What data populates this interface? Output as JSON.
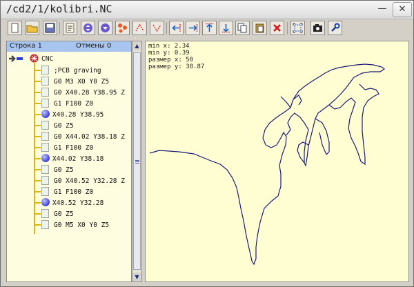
{
  "window": {
    "title": "/cd2/1/kolibri.NC"
  },
  "titlebar_buttons": {
    "minimize": "—",
    "close": "✕"
  },
  "toolbar": {
    "icons": [
      "new-file-icon",
      "open-folder-icon",
      "save-icon",
      "gcode-file-icon",
      "move-up-down-icon",
      "rotate-icon",
      "points-icon",
      "shape-up-icon",
      "shape-down-icon",
      "arrow-left-icon",
      "arrow-right-icon",
      "arrow-up-icon",
      "arrow-down-icon",
      "copy-icon",
      "paste-icon",
      "delete-icon",
      "select-frame-icon",
      "camera-icon",
      "settings-wrench-icon"
    ]
  },
  "panel": {
    "row_label": "Строка 1",
    "undo_label": "Отмены 0"
  },
  "tree": {
    "root": "CNC",
    "items": [
      {
        "text": ";PCB graving",
        "kind": "doc"
      },
      {
        "text": "G0 M3 X0 Y0 Z5",
        "kind": "doc"
      },
      {
        "text": "G0 X40.28 Y38.95 Z",
        "kind": "doc"
      },
      {
        "text": "G1 F100 Z0",
        "kind": "doc"
      },
      {
        "text": "X40.28 Y38.95",
        "kind": "circle"
      },
      {
        "text": "G0 Z5",
        "kind": "doc"
      },
      {
        "text": "G0 X44.02 Y38.18 Z",
        "kind": "doc"
      },
      {
        "text": "G1 F100 Z0",
        "kind": "doc"
      },
      {
        "text": "X44.02 Y38.18",
        "kind": "circle"
      },
      {
        "text": "G0 Z5",
        "kind": "doc"
      },
      {
        "text": "G0 X40.52 Y32.28 Z",
        "kind": "doc"
      },
      {
        "text": "G1 F100 Z0",
        "kind": "doc"
      },
      {
        "text": "X40.52 Y32.28",
        "kind": "circle"
      },
      {
        "text": "G0 Z5",
        "kind": "doc"
      },
      {
        "text": "G0 M5 X0 Y0 Z5",
        "kind": "doc"
      }
    ]
  },
  "canvas_info": {
    "min_x": "min x: 2.34",
    "min_y": "min y: 0.39",
    "size_x": "размер x: 50",
    "size_y": "размер y: 38.87"
  },
  "colors": {
    "outline": "#1a1a7a",
    "canvas_bg": "#fffdd2",
    "panel_bg": "#fffde0",
    "tree_line": "#e0b400",
    "header_bg": "#a7c5ef"
  }
}
